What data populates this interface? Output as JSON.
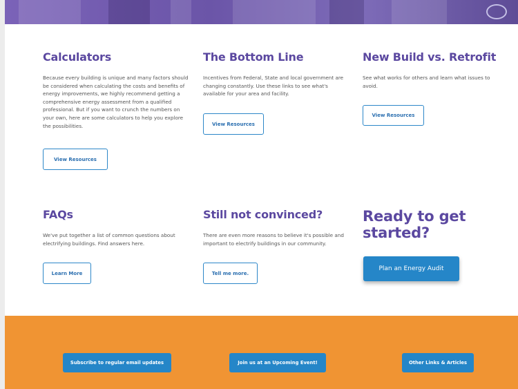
{
  "colors": {
    "heading_purple": "#5b48a0",
    "accent_blue": "#2586c8",
    "footer_orange": "#f09433",
    "body_text": "#555555"
  },
  "sections": {
    "calculators": {
      "title": "Calculators",
      "body": "Because every building is unique and many factors should be considered when calculating the costs and benefits of energy improvements, we highly recommend getting a comprehensive energy assessment from a qualified professional. But if you want to crunch the numbers on your own, here are some calculators to help you explore the possibilities.",
      "button": "View Resources"
    },
    "bottom_line": {
      "title": "The Bottom Line",
      "body": "Incentives from Federal, State and local government are changing constantly. Use these links to see what's available for your area and facility.",
      "button": "View Resources"
    },
    "new_build": {
      "title": "New Build vs. Retrofit",
      "body": "See what works for others and learn what issues to avoid.",
      "button": "View Resources"
    },
    "faqs": {
      "title": "FAQs",
      "body": "We've put together a list of common questions about electrifying buildings. Find answers here.",
      "button": "Learn More"
    },
    "not_convinced": {
      "title": "Still not convinced?",
      "body": "There are even more reasons to believe it's possible and important to electrify buildings in our community.",
      "button": "Tell me more."
    },
    "ready": {
      "title": "Ready to get started?",
      "button": "Plan an Energy Audit"
    }
  },
  "footer": {
    "subscribe": "Subscribe to regular email updates",
    "event": "Join us at an Upcoming Event!",
    "links": "Other Links & Articles"
  }
}
